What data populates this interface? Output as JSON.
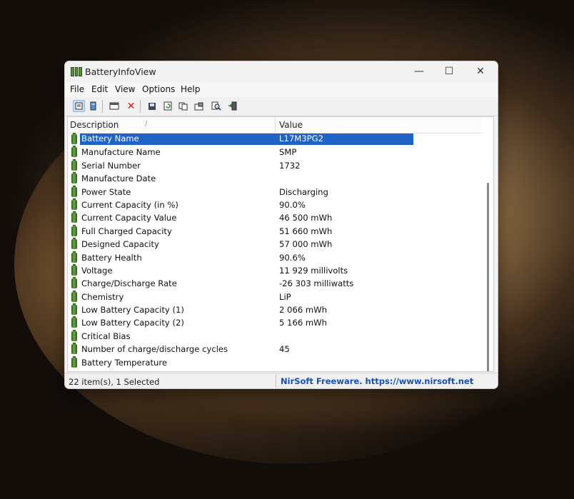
{
  "window": {
    "title": "BatteryInfoView",
    "minimize_glyph": "—",
    "maximize_glyph": "☐",
    "close_glyph": "✕"
  },
  "menu": [
    "File",
    "Edit",
    "View",
    "Options",
    "Help"
  ],
  "toolbar": {
    "buttons": [
      "battery-info-mode-icon",
      "battery-log-mode-icon",
      "html-report-icon",
      "delete-icon",
      "save-icon",
      "refresh-icon",
      "copy-icon",
      "properties-icon",
      "find-icon",
      "exit-icon"
    ],
    "delete_glyph": "✕"
  },
  "list": {
    "columns": {
      "description": "Description",
      "sort_indicator": "/",
      "value": "Value"
    },
    "rows": [
      {
        "description": "Battery Name",
        "value": "L17M3PG2",
        "selected": true
      },
      {
        "description": "Manufacture Name",
        "value": "SMP"
      },
      {
        "description": "Serial Number",
        "value": " 1732"
      },
      {
        "description": "Manufacture Date",
        "value": ""
      },
      {
        "description": "Power State",
        "value": "Discharging"
      },
      {
        "description": "Current Capacity (in %)",
        "value": "90.0%"
      },
      {
        "description": "Current Capacity Value",
        "value": "46 500 mWh"
      },
      {
        "description": "Full Charged Capacity",
        "value": "51 660 mWh"
      },
      {
        "description": "Designed Capacity",
        "value": "57 000 mWh"
      },
      {
        "description": "Battery Health",
        "value": "90.6%"
      },
      {
        "description": "Voltage",
        "value": "11 929 millivolts"
      },
      {
        "description": "Charge/Discharge Rate",
        "value": "-26 303 milliwatts"
      },
      {
        "description": "Chemistry",
        "value": "LiP"
      },
      {
        "description": "Low Battery Capacity (1)",
        "value": "2 066 mWh"
      },
      {
        "description": "Low Battery Capacity (2)",
        "value": "5 166 mWh"
      },
      {
        "description": "Critical Bias",
        "value": ""
      },
      {
        "description": "Number of charge/discharge cycles",
        "value": "45"
      },
      {
        "description": "Battery Temperature",
        "value": ""
      }
    ]
  },
  "status": {
    "items": "22 item(s), 1 Selected",
    "credit": "NirSoft Freeware. https://www.nirsoft.net"
  },
  "colors": {
    "selection": "#1f63c9",
    "battery_icon": "#5a8d3b",
    "credit_link": "#1a4fb8"
  }
}
